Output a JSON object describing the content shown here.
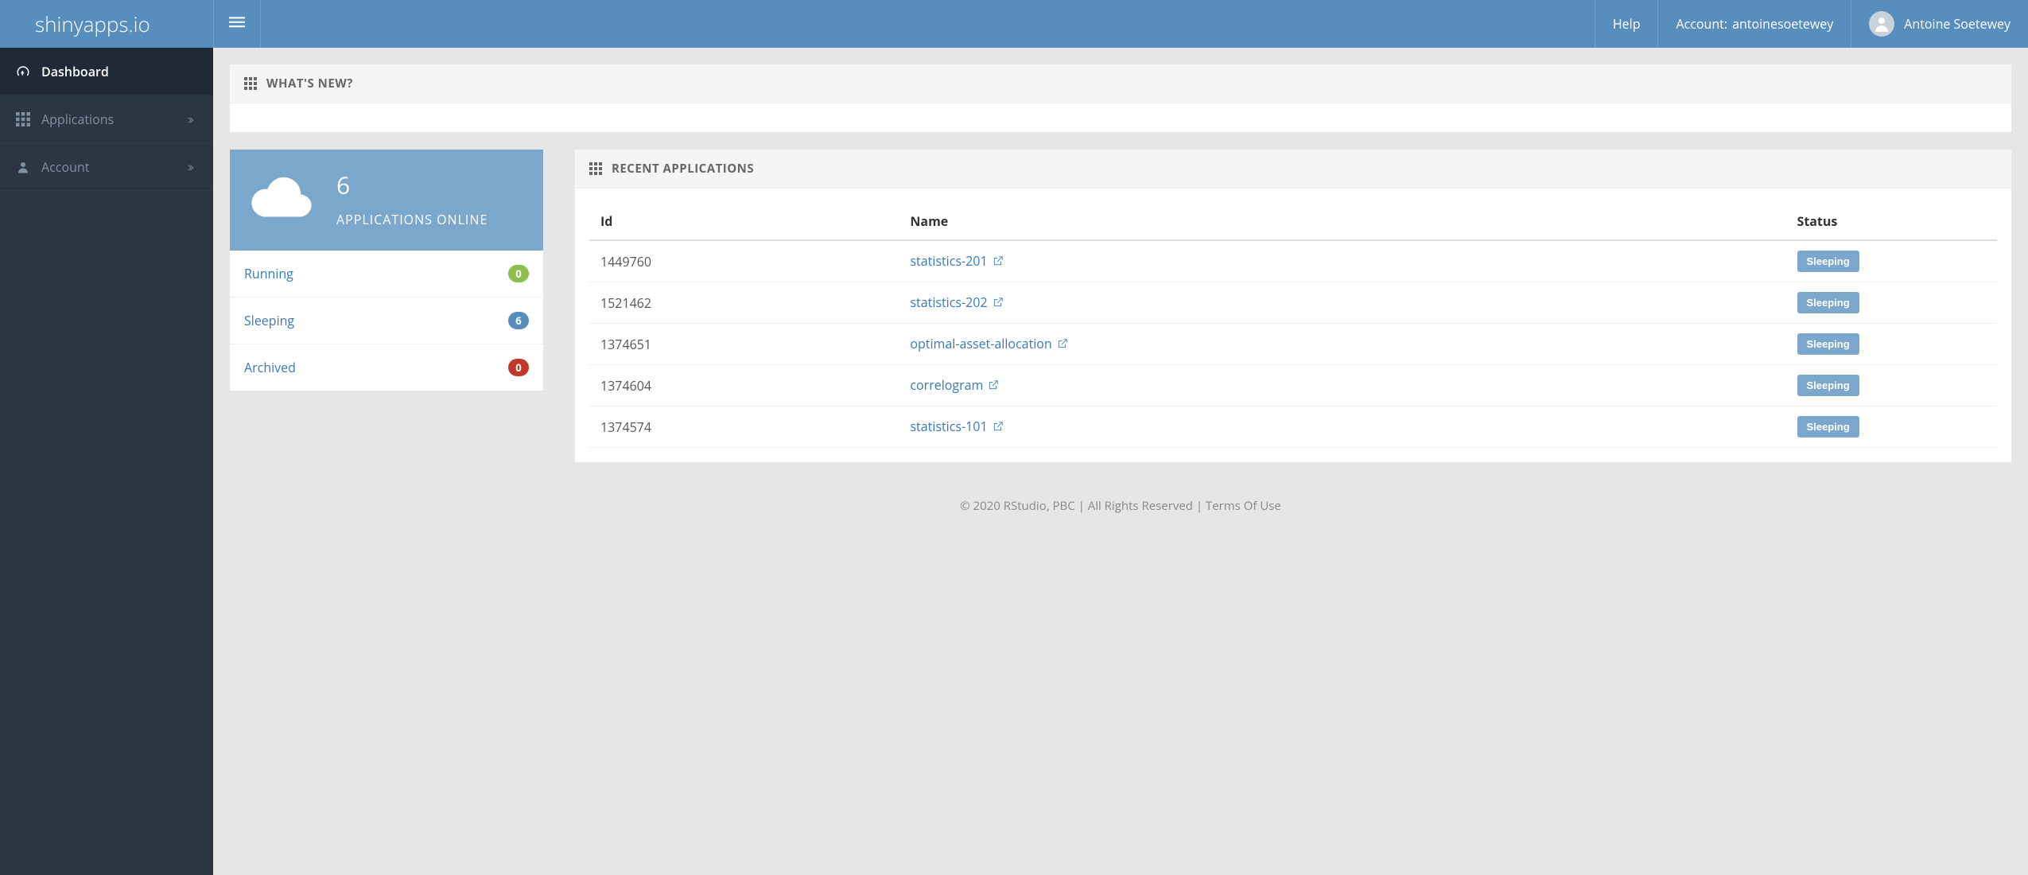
{
  "header": {
    "logo": "shinyapps.io",
    "help": "Help",
    "account_label": "Account:",
    "account_name": "antoinesoetewey",
    "user_display": "Antoine Soetewey"
  },
  "sidebar": {
    "items": [
      {
        "label": "Dashboard",
        "icon": "dashboard",
        "active": true,
        "expandable": false
      },
      {
        "label": "Applications",
        "icon": "grid",
        "active": false,
        "expandable": true
      },
      {
        "label": "Account",
        "icon": "user",
        "active": false,
        "expandable": true
      }
    ]
  },
  "whats_new": {
    "title": "WHAT'S NEW?"
  },
  "stats": {
    "count": "6",
    "label": "APPLICATIONS ONLINE",
    "states": [
      {
        "label": "Running",
        "count": "0",
        "color": "green"
      },
      {
        "label": "Sleeping",
        "count": "6",
        "color": "blue"
      },
      {
        "label": "Archived",
        "count": "0",
        "color": "red"
      }
    ]
  },
  "recent": {
    "title": "RECENT APPLICATIONS",
    "columns": {
      "id": "Id",
      "name": "Name",
      "status": "Status"
    },
    "rows": [
      {
        "id": "1449760",
        "name": "statistics-201",
        "status": "Sleeping"
      },
      {
        "id": "1521462",
        "name": "statistics-202",
        "status": "Sleeping"
      },
      {
        "id": "1374651",
        "name": "optimal-asset-allocation",
        "status": "Sleeping"
      },
      {
        "id": "1374604",
        "name": "correlogram",
        "status": "Sleeping"
      },
      {
        "id": "1374574",
        "name": "statistics-101",
        "status": "Sleeping"
      }
    ]
  },
  "footer": {
    "copyright": "© 2020 RStudio, PBC",
    "rights": "All Rights Reserved",
    "terms": "Terms Of Use"
  }
}
